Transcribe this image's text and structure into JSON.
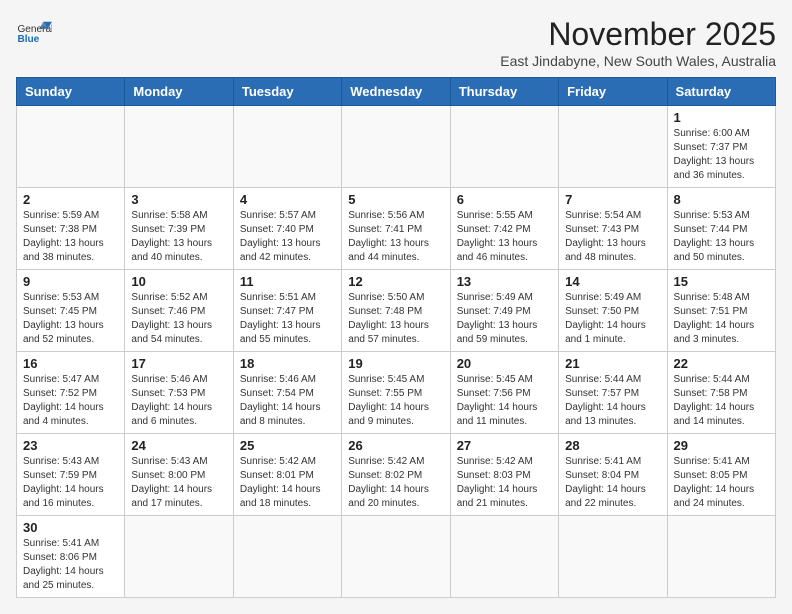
{
  "logo": {
    "text_general": "General",
    "text_blue": "Blue"
  },
  "header": {
    "month_title": "November 2025",
    "subtitle": "East Jindabyne, New South Wales, Australia"
  },
  "weekdays": [
    "Sunday",
    "Monday",
    "Tuesday",
    "Wednesday",
    "Thursday",
    "Friday",
    "Saturday"
  ],
  "weeks": [
    [
      {
        "day": "",
        "info": ""
      },
      {
        "day": "",
        "info": ""
      },
      {
        "day": "",
        "info": ""
      },
      {
        "day": "",
        "info": ""
      },
      {
        "day": "",
        "info": ""
      },
      {
        "day": "",
        "info": ""
      },
      {
        "day": "1",
        "info": "Sunrise: 6:00 AM\nSunset: 7:37 PM\nDaylight: 13 hours\nand 36 minutes."
      }
    ],
    [
      {
        "day": "2",
        "info": "Sunrise: 5:59 AM\nSunset: 7:38 PM\nDaylight: 13 hours\nand 38 minutes."
      },
      {
        "day": "3",
        "info": "Sunrise: 5:58 AM\nSunset: 7:39 PM\nDaylight: 13 hours\nand 40 minutes."
      },
      {
        "day": "4",
        "info": "Sunrise: 5:57 AM\nSunset: 7:40 PM\nDaylight: 13 hours\nand 42 minutes."
      },
      {
        "day": "5",
        "info": "Sunrise: 5:56 AM\nSunset: 7:41 PM\nDaylight: 13 hours\nand 44 minutes."
      },
      {
        "day": "6",
        "info": "Sunrise: 5:55 AM\nSunset: 7:42 PM\nDaylight: 13 hours\nand 46 minutes."
      },
      {
        "day": "7",
        "info": "Sunrise: 5:54 AM\nSunset: 7:43 PM\nDaylight: 13 hours\nand 48 minutes."
      },
      {
        "day": "8",
        "info": "Sunrise: 5:53 AM\nSunset: 7:44 PM\nDaylight: 13 hours\nand 50 minutes."
      }
    ],
    [
      {
        "day": "9",
        "info": "Sunrise: 5:53 AM\nSunset: 7:45 PM\nDaylight: 13 hours\nand 52 minutes."
      },
      {
        "day": "10",
        "info": "Sunrise: 5:52 AM\nSunset: 7:46 PM\nDaylight: 13 hours\nand 54 minutes."
      },
      {
        "day": "11",
        "info": "Sunrise: 5:51 AM\nSunset: 7:47 PM\nDaylight: 13 hours\nand 55 minutes."
      },
      {
        "day": "12",
        "info": "Sunrise: 5:50 AM\nSunset: 7:48 PM\nDaylight: 13 hours\nand 57 minutes."
      },
      {
        "day": "13",
        "info": "Sunrise: 5:49 AM\nSunset: 7:49 PM\nDaylight: 13 hours\nand 59 minutes."
      },
      {
        "day": "14",
        "info": "Sunrise: 5:49 AM\nSunset: 7:50 PM\nDaylight: 14 hours\nand 1 minute."
      },
      {
        "day": "15",
        "info": "Sunrise: 5:48 AM\nSunset: 7:51 PM\nDaylight: 14 hours\nand 3 minutes."
      }
    ],
    [
      {
        "day": "16",
        "info": "Sunrise: 5:47 AM\nSunset: 7:52 PM\nDaylight: 14 hours\nand 4 minutes."
      },
      {
        "day": "17",
        "info": "Sunrise: 5:46 AM\nSunset: 7:53 PM\nDaylight: 14 hours\nand 6 minutes."
      },
      {
        "day": "18",
        "info": "Sunrise: 5:46 AM\nSunset: 7:54 PM\nDaylight: 14 hours\nand 8 minutes."
      },
      {
        "day": "19",
        "info": "Sunrise: 5:45 AM\nSunset: 7:55 PM\nDaylight: 14 hours\nand 9 minutes."
      },
      {
        "day": "20",
        "info": "Sunrise: 5:45 AM\nSunset: 7:56 PM\nDaylight: 14 hours\nand 11 minutes."
      },
      {
        "day": "21",
        "info": "Sunrise: 5:44 AM\nSunset: 7:57 PM\nDaylight: 14 hours\nand 13 minutes."
      },
      {
        "day": "22",
        "info": "Sunrise: 5:44 AM\nSunset: 7:58 PM\nDaylight: 14 hours\nand 14 minutes."
      }
    ],
    [
      {
        "day": "23",
        "info": "Sunrise: 5:43 AM\nSunset: 7:59 PM\nDaylight: 14 hours\nand 16 minutes."
      },
      {
        "day": "24",
        "info": "Sunrise: 5:43 AM\nSunset: 8:00 PM\nDaylight: 14 hours\nand 17 minutes."
      },
      {
        "day": "25",
        "info": "Sunrise: 5:42 AM\nSunset: 8:01 PM\nDaylight: 14 hours\nand 18 minutes."
      },
      {
        "day": "26",
        "info": "Sunrise: 5:42 AM\nSunset: 8:02 PM\nDaylight: 14 hours\nand 20 minutes."
      },
      {
        "day": "27",
        "info": "Sunrise: 5:42 AM\nSunset: 8:03 PM\nDaylight: 14 hours\nand 21 minutes."
      },
      {
        "day": "28",
        "info": "Sunrise: 5:41 AM\nSunset: 8:04 PM\nDaylight: 14 hours\nand 22 minutes."
      },
      {
        "day": "29",
        "info": "Sunrise: 5:41 AM\nSunset: 8:05 PM\nDaylight: 14 hours\nand 24 minutes."
      }
    ],
    [
      {
        "day": "30",
        "info": "Sunrise: 5:41 AM\nSunset: 8:06 PM\nDaylight: 14 hours\nand 25 minutes."
      },
      {
        "day": "",
        "info": ""
      },
      {
        "day": "",
        "info": ""
      },
      {
        "day": "",
        "info": ""
      },
      {
        "day": "",
        "info": ""
      },
      {
        "day": "",
        "info": ""
      },
      {
        "day": "",
        "info": ""
      }
    ]
  ]
}
